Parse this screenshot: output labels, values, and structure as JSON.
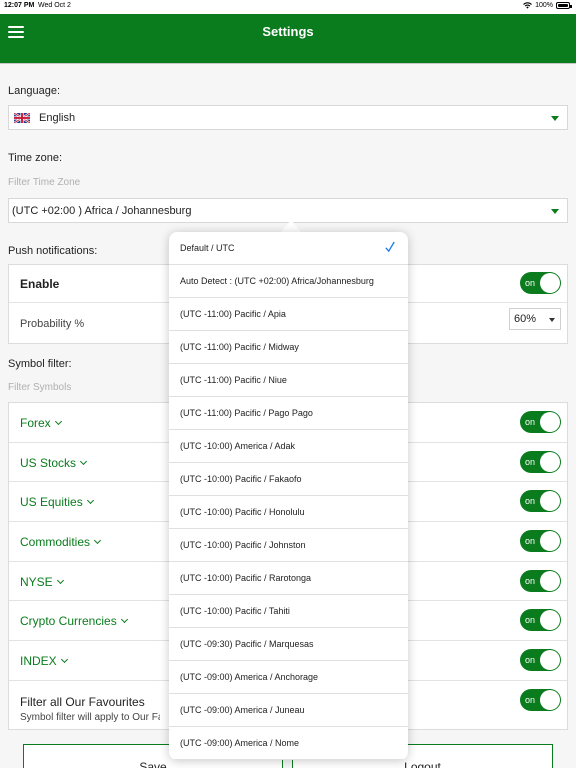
{
  "status_bar": {
    "time": "12:07 PM",
    "date": "Wed Oct 2",
    "battery": "100%"
  },
  "app_bar": {
    "title": "Settings"
  },
  "language": {
    "label": "Language:",
    "selected": "English"
  },
  "timezone": {
    "label": "Time zone:",
    "filter_placeholder": "Filter Time Zone",
    "selected": "(UTC +02:00 ) Africa / Johannesburg"
  },
  "push": {
    "label": "Push notifications:",
    "enable_label": "Enable",
    "enable_toggle": "on",
    "probability_label": "Probability %",
    "probability_value": "60%"
  },
  "symbol_filter": {
    "label": "Symbol filter:",
    "filter_placeholder": "Filter Symbols",
    "items": [
      {
        "label": "Forex",
        "toggle": "on"
      },
      {
        "label": "US Stocks",
        "toggle": "on"
      },
      {
        "label": "US Equities",
        "toggle": "on"
      },
      {
        "label": "Commodities",
        "toggle": "on"
      },
      {
        "label": "NYSE",
        "toggle": "on"
      },
      {
        "label": "Crypto Currencies",
        "toggle": "on"
      },
      {
        "label": "INDEX",
        "toggle": "on"
      }
    ],
    "favourites_label": "Filter all Our Favourites",
    "favourites_desc": "Symbol filter will apply to Our Fa",
    "favourites_toggle": "on"
  },
  "buttons": {
    "save": "Save",
    "logout": "Logout"
  },
  "timezone_dropdown": {
    "items": [
      "Default / UTC",
      "Auto Detect : (UTC +02:00) Africa/Johannesburg",
      "(UTC -11:00) Pacific / Apia",
      "(UTC -11:00) Pacific / Midway",
      "(UTC -11:00) Pacific / Niue",
      "(UTC -11:00) Pacific / Pago Pago",
      "(UTC -10:00) America / Adak",
      "(UTC -10:00) Pacific / Fakaofo",
      "(UTC -10:00) Pacific / Honolulu",
      "(UTC -10:00) Pacific / Johnston",
      "(UTC -10:00) Pacific / Rarotonga",
      "(UTC -10:00) Pacific / Tahiti",
      "(UTC -09:30) Pacific / Marquesas",
      "(UTC -09:00) America / Anchorage",
      "(UTC -09:00) America / Juneau",
      "(UTC -09:00) America / Nome"
    ],
    "selected_index": 0
  },
  "colors": {
    "brand": "#0a7c1d",
    "check": "#1a7bf2"
  }
}
